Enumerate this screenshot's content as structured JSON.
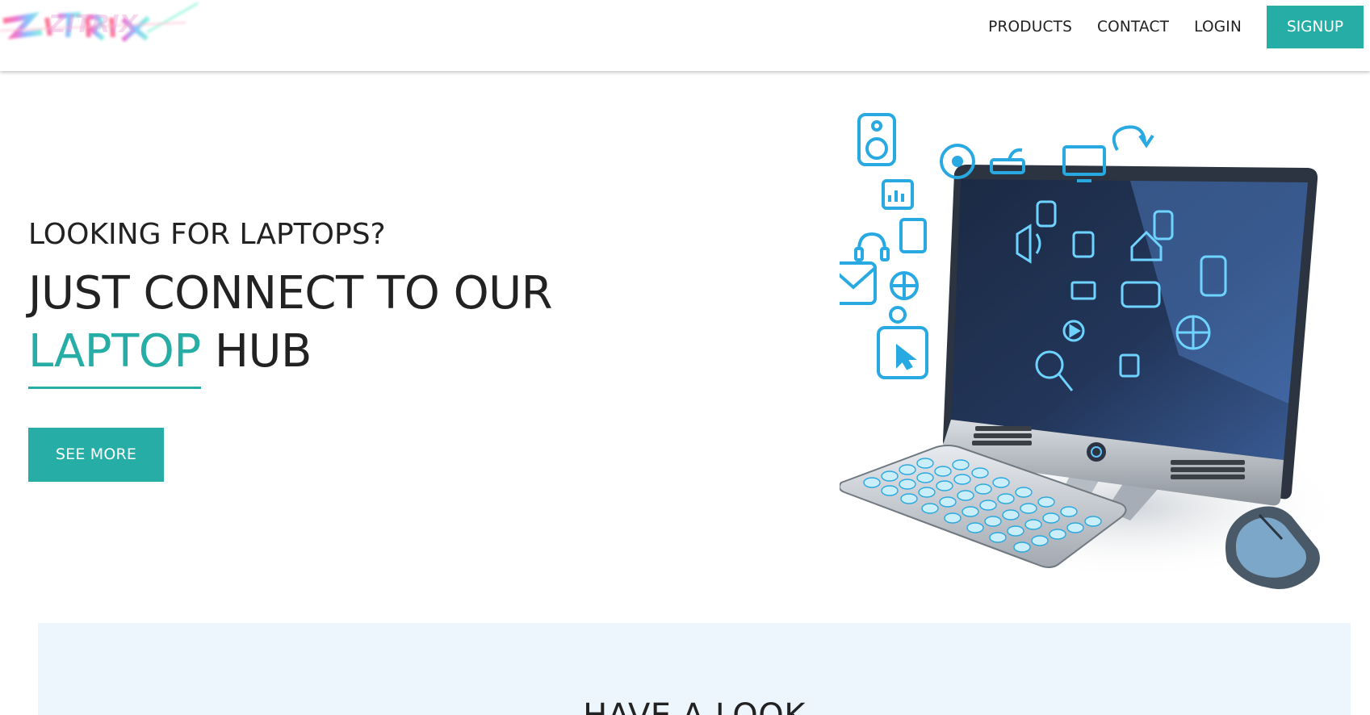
{
  "brand": {
    "logo_text": "ZITRIX"
  },
  "nav": {
    "products": "PRODUCTS",
    "contact": "CONTACT",
    "login": "LOGIN",
    "signup": "SIGNUP"
  },
  "hero": {
    "eyebrow": "LOOKING FOR LAPTOPS?",
    "headline_line1": "JUST CONNECT TO OUR",
    "headline_accent": "LAPTOP",
    "headline_rest": " HUB",
    "cta_label": "SEE MORE"
  },
  "section": {
    "title": "HAVE A LOOK"
  },
  "colors": {
    "accent": "#25ada6",
    "section_bg": "#eef6fd",
    "text": "#222222",
    "icon_blue": "#29a9e1"
  }
}
